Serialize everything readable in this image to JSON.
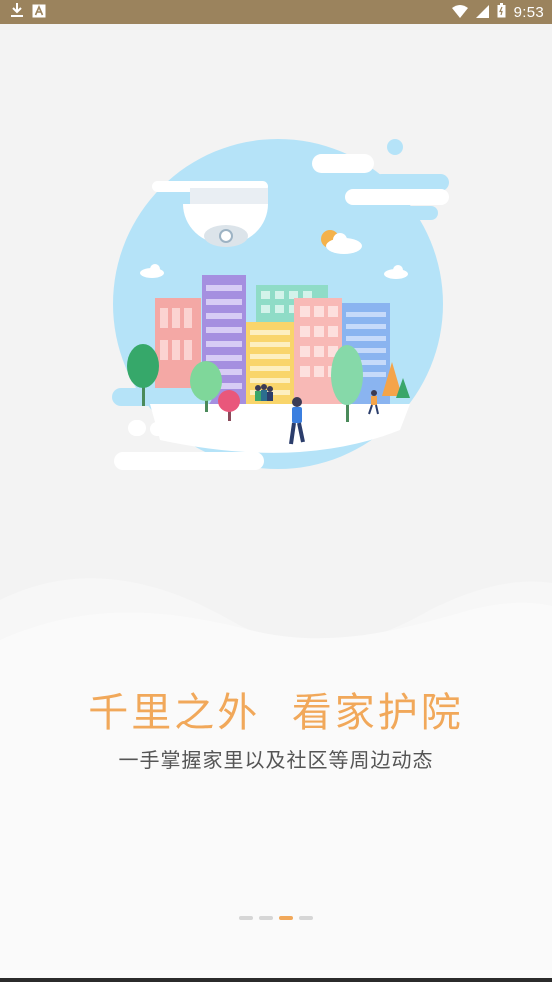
{
  "status_bar": {
    "time": "9:53",
    "icons": [
      "download-icon",
      "notification-a-icon",
      "wifi-icon",
      "signal-icon",
      "battery-icon"
    ]
  },
  "onboarding": {
    "title": "千里之外  看家护院",
    "subtitle": "一手掌握家里以及社区等周边动态",
    "page_count": 4,
    "active_page": 3,
    "illustration": "security-camera-city-illustration"
  },
  "colors": {
    "status_bar_bg": "#9b835d",
    "accent": "#f1a85a",
    "sky": "#b5e3f8",
    "background": "#f3f3f3"
  }
}
